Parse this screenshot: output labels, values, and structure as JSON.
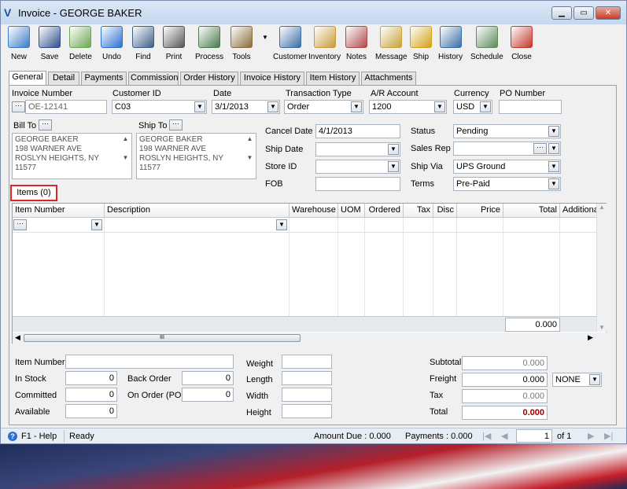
{
  "window": {
    "title": "Invoice - GEORGE BAKER",
    "logo": "V",
    "min": "▁",
    "max": "▭",
    "close": "✕"
  },
  "toolbar": [
    {
      "label": "New",
      "icon": "new-document-icon",
      "color": "#3a7bc8"
    },
    {
      "label": "Save",
      "icon": "floppy-disk-icon",
      "color": "#2f4f8f"
    },
    {
      "label": "Delete",
      "icon": "recycle-bin-icon",
      "color": "#6aa84f"
    },
    {
      "label": "Undo",
      "icon": "undo-arrow-icon",
      "color": "#2a6fd1"
    },
    {
      "label": "Find",
      "icon": "binoculars-icon",
      "color": "#3e5f8a"
    },
    {
      "label": "Print",
      "icon": "printer-icon",
      "color": "#555555"
    },
    {
      "label": "Process",
      "icon": "gears-icon",
      "color": "#4a7a4a"
    },
    {
      "label": "Tools",
      "icon": "tools-icon",
      "color": "#8a6d3b"
    },
    {
      "label": "Customer",
      "icon": "person-icon",
      "color": "#3a6ea5"
    },
    {
      "label": "Inventory",
      "icon": "boxes-icon",
      "color": "#c89b3c"
    },
    {
      "label": "Notes",
      "icon": "notepad-icon",
      "color": "#b04a4a"
    },
    {
      "label": "Message",
      "icon": "message-board-icon",
      "color": "#c8a23c"
    },
    {
      "label": "Ship",
      "icon": "forklift-icon",
      "color": "#d4a017"
    },
    {
      "label": "History",
      "icon": "history-person-icon",
      "color": "#3a6ea5"
    },
    {
      "label": "Schedule",
      "icon": "calendar-icon",
      "color": "#5a8a5a"
    },
    {
      "label": "Close",
      "icon": "close-door-icon",
      "color": "#c0392b"
    }
  ],
  "tabs": [
    "General",
    "Detail",
    "Payments",
    "Commission",
    "Order History",
    "Invoice History",
    "Item History",
    "Attachments"
  ],
  "header": {
    "invoice_number_label": "Invoice Number",
    "invoice_number": "OE-12141",
    "customer_id_label": "Customer ID",
    "customer_id": "C03",
    "date_label": "Date",
    "date": "3/1/2013",
    "transaction_type_label": "Transaction Type",
    "transaction_type": "Order",
    "ar_account_label": "A/R Account",
    "ar_account": "1200",
    "currency_label": "Currency",
    "currency": "USD",
    "po_number_label": "PO Number",
    "po_number": ""
  },
  "bill_to": {
    "label": "Bill To",
    "lines": [
      "GEORGE BAKER",
      "198 WARNER AVE",
      "ROSLYN HEIGHTS, NY",
      "11577"
    ]
  },
  "ship_to": {
    "label": "Ship To",
    "lines": [
      "GEORGE BAKER",
      "198 WARNER AVE",
      "ROSLYN HEIGHTS, NY",
      "11577"
    ]
  },
  "mid": {
    "cancel_date_label": "Cancel  Date",
    "cancel_date": "4/1/2013",
    "ship_date_label": "Ship Date",
    "ship_date": "",
    "store_id_label": "Store ID",
    "store_id": "",
    "fob_label": "FOB",
    "fob": ""
  },
  "right": {
    "status_label": "Status",
    "status": "Pending",
    "sales_rep_label": "Sales Rep",
    "sales_rep": "",
    "ship_via_label": "Ship Via",
    "ship_via": "UPS Ground",
    "terms_label": "Terms",
    "terms": "Pre-Paid"
  },
  "items_tab": "Items (0)",
  "grid": {
    "columns": [
      "Item Number",
      "Description",
      "Warehouse",
      "UOM",
      "Ordered",
      "Tax",
      "Disc",
      "Price",
      "Total",
      "Additiona"
    ],
    "total": "0.000",
    "scroll_mark": "III"
  },
  "bottom": {
    "item_number_label": "Item Number",
    "item_number": "",
    "in_stock_label": "In Stock",
    "in_stock": "0",
    "committed_label": "Committed",
    "committed": "0",
    "available_label": "Available",
    "available": "0",
    "back_order_label": "Back Order",
    "back_order": "0",
    "on_order_label": "On Order (PO)",
    "on_order": "0",
    "weight_label": "Weight",
    "length_label": "Length",
    "width_label": "Width",
    "height_label": "Height",
    "subtotal_label": "Subtotal",
    "subtotal": "0.000",
    "freight_label": "Freight",
    "freight": "0.000",
    "freight_type": "NONE",
    "tax_label": "Tax",
    "tax": "0.000",
    "total_label": "Total",
    "total": "0.000"
  },
  "status": {
    "help": "F1 - Help",
    "ready": "Ready",
    "amount_due": "Amount Due : 0.000",
    "payments": "Payments : 0.000",
    "page": "1",
    "of": "of  1"
  },
  "colors": {
    "accent": "#1b4fa0",
    "total_red": "#a00000",
    "highlight_box": "#d9242b"
  }
}
